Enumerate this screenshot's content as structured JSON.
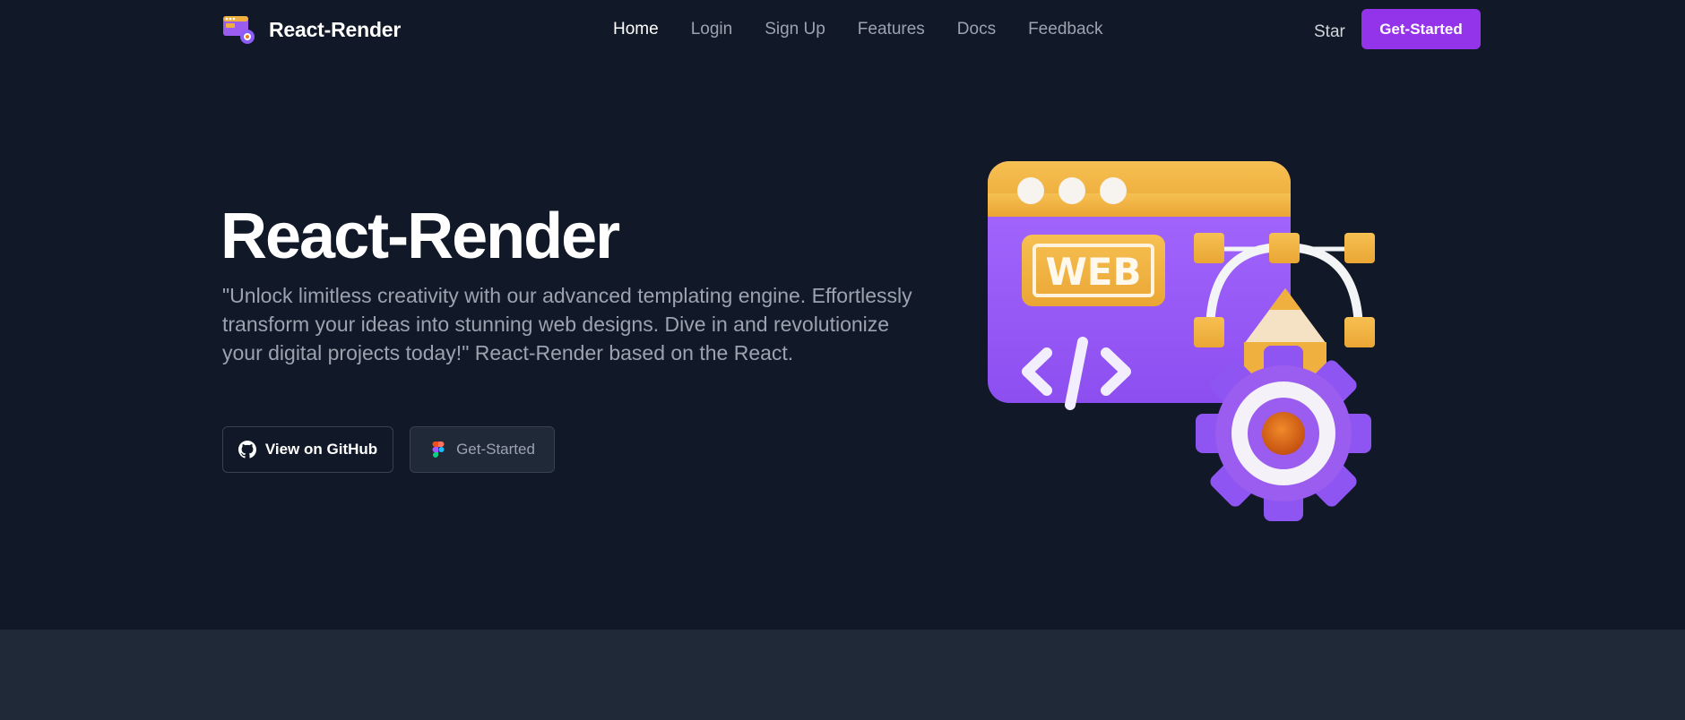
{
  "brand": {
    "name": "React-Render",
    "logo_icon": "web-settings-logo-icon"
  },
  "nav": {
    "items": [
      {
        "label": "Home",
        "active": true
      },
      {
        "label": "Login",
        "active": false
      },
      {
        "label": "Sign Up",
        "active": false
      },
      {
        "label": "Features",
        "active": false
      },
      {
        "label": "Docs",
        "active": false
      },
      {
        "label": "Feedback",
        "active": false
      }
    ]
  },
  "header": {
    "star_label": "Star",
    "cta_label": "Get-Started"
  },
  "hero": {
    "title": "React-Render",
    "description": "\"Unlock limitless creativity with our advanced templating engine. Effortlessly transform your ideas into stunning web designs. Dive in and revolutionize your digital projects today!\" React-Render based on the React.",
    "github_button": {
      "label": "View on GitHub",
      "icon": "github-icon"
    },
    "start_button": {
      "label": "Get-Started",
      "icon": "figma-icon"
    },
    "illustration": {
      "icon": "web-design-gear-illustration",
      "badge_text": "WEB"
    }
  },
  "colors": {
    "background": "#111827",
    "accent": "#9333ea",
    "band": "#1f2937",
    "illustration_purple": "#9b5cf0",
    "illustration_orange": "#f0b040"
  }
}
